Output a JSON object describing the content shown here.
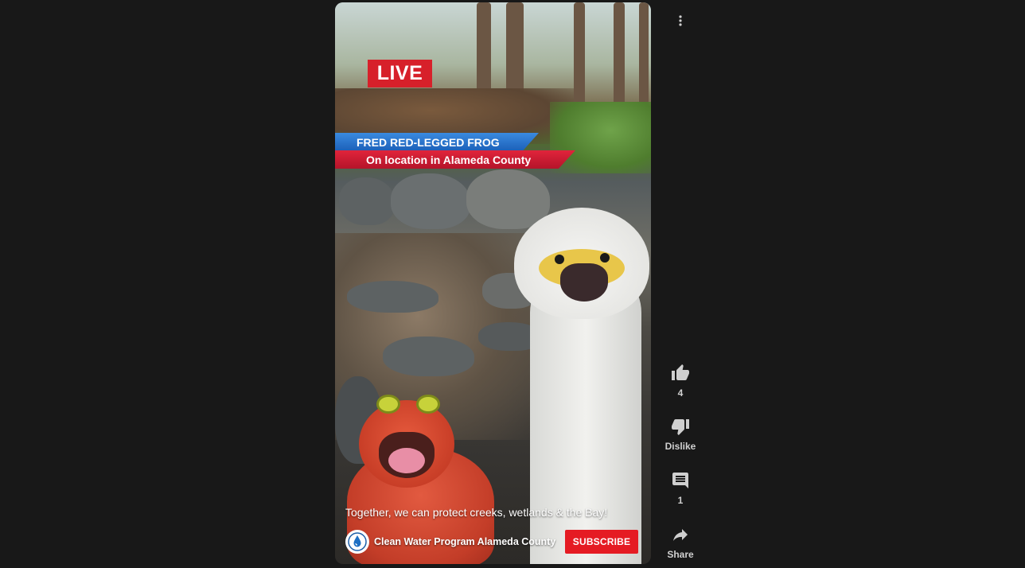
{
  "video": {
    "live_badge": "LIVE",
    "lower_third_title": "FRED RED-LEGGED FROG",
    "lower_third_subtitle": "On location in Alameda County",
    "caption": "Together, we can protect creeks, wetlands & the Bay!",
    "channel_name": "Clean Water Program Alameda County",
    "subscribe_label": "SUBSCRIBE"
  },
  "actions": {
    "like_count": "4",
    "dislike_label": "Dislike",
    "comment_count": "1",
    "share_label": "Share"
  },
  "colors": {
    "background": "#181818",
    "live_red": "#d7202a",
    "subscribe_red": "#e51b23",
    "lower_third_blue": "#1c5fb8",
    "lower_third_red": "#c8182f"
  },
  "icons": [
    "more-vert-icon",
    "thumbs-up-icon",
    "thumbs-down-icon",
    "comment-icon",
    "share-icon",
    "channel-logo-icon"
  ]
}
